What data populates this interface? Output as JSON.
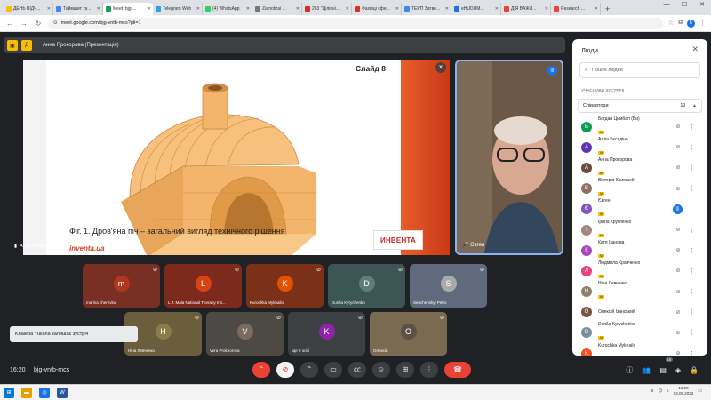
{
  "browser": {
    "tabs": [
      {
        "label": "ДЕНЬ ВІДЧ...",
        "color": "#fbbc04"
      },
      {
        "label": "Таймшит та ...",
        "color": "#4285f4"
      },
      {
        "label": "Meet: bjg-...",
        "color": "#0f9d58"
      },
      {
        "label": "Telegram Web",
        "color": "#29a3e6"
      },
      {
        "label": "(4) WhatsApp",
        "color": "#25d366"
      },
      {
        "label": "Zamobrai ...",
        "color": "#777777"
      },
      {
        "label": "263 \"Цілісні...",
        "color": "#d93025"
      },
      {
        "label": "Фахівці сфе...",
        "color": "#d93025"
      },
      {
        "label": "ТЕРП Затве...",
        "color": "#4285f4"
      },
      {
        "label": "eHUDUM...",
        "color": "#1a73e8"
      },
      {
        "label": "ДІЯ ВАЖЛ...",
        "color": "#ea4335"
      },
      {
        "label": "Research ...",
        "color": "#ea4335"
      }
    ],
    "url": "meet.google.com/bjg-vntb-mcs?pli=1",
    "profile_initial": "E"
  },
  "meet": {
    "presenter_title": "Анна Прокорова (Презентація)",
    "presenter_label": "Анна Прокорова",
    "speaker_name": "Євген",
    "time": "16:20",
    "meeting_code": "bjg-vntb-mcs",
    "people_count_badge": "19"
  },
  "slide": {
    "number": "Слайд 8",
    "caption": "Фіг. 1. Дров'яна піч – загальний вигляд технічного рішення",
    "brand": "inventa.ua",
    "logo_text": "ИНВЕНТА"
  },
  "tiles_row1": [
    {
      "initial": "m",
      "name": "marina cherevko",
      "color": "#b0381e",
      "bg": "#7a2f24"
    },
    {
      "initial": "L",
      "name": "L.T. Mala National Therapy Ins...",
      "color": "#d84315",
      "bg": "#7d2a1c"
    },
    {
      "initial": "K",
      "name": "Kurochka Mykhailo",
      "color": "#e65100",
      "bg": "#7b3118"
    },
    {
      "initial": "D",
      "name": "Dunka Kyrychenko",
      "color": "#5f7d7a",
      "bg": "#3b5655"
    },
    {
      "initial": "S",
      "name": "Senchenskyi Petro",
      "color": "#aaaaaa",
      "bg": "#5f6b7d"
    }
  ],
  "tiles_row2": [
    {
      "initial": "Н",
      "name": "Ніна Левченко",
      "color": "#8a7b4a",
      "bg": "#6a5e3c"
    },
    {
      "initial": "V",
      "name": "Vera Prokhorova",
      "color": "#7a6b5c",
      "bg": "#4d4a44"
    },
    {
      "initial": "K",
      "name": "Ще 9 осіб",
      "color": "#8e24aa",
      "bg": "#3c4043"
    },
    {
      "initial": "О",
      "name": "Олексій",
      "color": "#5b5144",
      "bg": "#7a6a52"
    }
  ],
  "toast": "Khalepa Yuliana залишає зустріч",
  "people_panel": {
    "title": "Люди",
    "search_placeholder": "Пошук людей",
    "subtitle": "УЧАСНИКИ ЗУСТРІЧІ",
    "section_label": "Співавтори",
    "section_count": "19",
    "rows": [
      {
        "initial": "Б",
        "name": "Богдан Цимбал (Ви)",
        "tag": "М",
        "color": "#0f9d58"
      },
      {
        "initial": "А",
        "name": "Алла Бєсєдіна",
        "tag": "М",
        "color": "#5e35b1"
      },
      {
        "initial": "А",
        "name": "Анна Прокорова",
        "tag": "М",
        "color": "#6d4c41"
      },
      {
        "initial": "В",
        "name": "Вікторія Криошей",
        "tag": "М",
        "color": "#8d6e63"
      },
      {
        "initial": "Є",
        "name": "Євген",
        "tag": "М",
        "color": "#7e57c2",
        "speaking": true
      },
      {
        "initial": "І",
        "name": "Ірина Кругленко",
        "tag": "М",
        "color": "#a1887f"
      },
      {
        "initial": "К",
        "name": "Катя Ізанова",
        "tag": "М",
        "color": "#ab47bc"
      },
      {
        "initial": "Л",
        "name": "Людмила Кравченко",
        "tag": "М",
        "color": "#ec407a"
      },
      {
        "initial": "Н",
        "name": "Ніна Левченко",
        "tag": "М",
        "color": "#8d8066"
      },
      {
        "initial": "О",
        "name": "Олексій Ізанський",
        "tag": "",
        "color": "#795548"
      },
      {
        "initial": "D",
        "name": "Danila Kyrychenko",
        "tag": "М",
        "color": "#78909c"
      },
      {
        "initial": "K",
        "name": "Kurochka Mykhailo",
        "tag": "М",
        "color": "#f4511e"
      }
    ]
  },
  "taskbar": {
    "clock_time": "16:20",
    "clock_date": "03.08.2023"
  }
}
